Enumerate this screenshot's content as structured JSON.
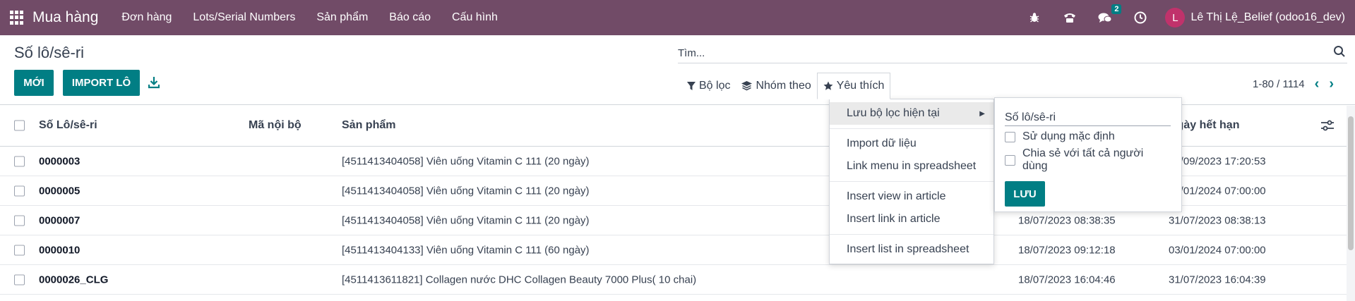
{
  "navbar": {
    "app_name": "Mua hàng",
    "menu": [
      "Đơn hàng",
      "Lots/Serial Numbers",
      "Sản phẩm",
      "Báo cáo",
      "Cấu hình"
    ],
    "messages_count": "2",
    "avatar_letter": "L",
    "user_name": "Lê Thị Lệ_Belief (odoo16_dev)"
  },
  "page": {
    "title": "Số lô/sê-ri",
    "new_label": "MỚI",
    "import_label": "IMPORT LÔ"
  },
  "search": {
    "placeholder": "Tìm..."
  },
  "filters": {
    "filter_label": "Bộ lọc",
    "groupby_label": "Nhóm theo",
    "favorites_label": "Yêu thích"
  },
  "pager": {
    "text": "1-80 / 1114"
  },
  "table": {
    "headers": {
      "lot": "Số Lô/sê-ri",
      "ref": "Mã nội bộ",
      "product": "Sản phẩm",
      "expiry": "Ngày hết hạn"
    },
    "rows": [
      {
        "lot": "0000003",
        "ref": "",
        "product": "[4511413404058] Viên uống Vitamin C 111 (20 ngày)",
        "date1": "",
        "date2": "31/09/2023 17:20:53"
      },
      {
        "lot": "0000005",
        "ref": "",
        "product": "[4511413404058] Viên uống Vitamin C 111 (20 ngày)",
        "date1": "",
        "date2": "03/01/2024 07:00:00"
      },
      {
        "lot": "0000007",
        "ref": "",
        "product": "[4511413404058] Viên uống Vitamin C 111 (20 ngày)",
        "date1": "18/07/2023 08:38:35",
        "date2": "31/07/2023 08:38:13"
      },
      {
        "lot": "0000010",
        "ref": "",
        "product": "[4511413404133] Viên uống Vitamin C 111 (60 ngày)",
        "date1": "18/07/2023 09:12:18",
        "date2": "03/01/2024 07:00:00"
      },
      {
        "lot": "0000026_CLG",
        "ref": "",
        "product": "[4511413611821] Collagen nước DHC Collagen Beauty 7000 Plus( 10 chai)",
        "date1": "18/07/2023 16:04:46",
        "date2": "31/07/2023 16:04:39"
      }
    ]
  },
  "favorites_menu": {
    "save_current": "Lưu bộ lọc hiện tại",
    "import_data": "Import dữ liệu",
    "link_menu_spreadsheet": "Link menu in spreadsheet",
    "insert_view_article": "Insert view in article",
    "insert_link_article": "Insert link in article",
    "insert_list_spreadsheet": "Insert list in spreadsheet"
  },
  "save_filter": {
    "name_value": "Số lô/sê-ri",
    "default_label": "Sử dụng mặc định",
    "share_label": "Chia sẻ với tất cả người dùng",
    "save_label": "LƯU"
  },
  "colors": {
    "navbar": "#714B67",
    "primary": "#017e84",
    "avatar": "#c0326b"
  },
  "icons": [
    "apps-grid-icon",
    "bug-icon",
    "phone-icon",
    "chat-icon",
    "clock-icon",
    "search-icon",
    "download-icon",
    "filter-icon",
    "layers-icon",
    "star-icon",
    "chevron-left-icon",
    "chevron-right-icon",
    "column-settings-icon",
    "caret-right-icon"
  ]
}
